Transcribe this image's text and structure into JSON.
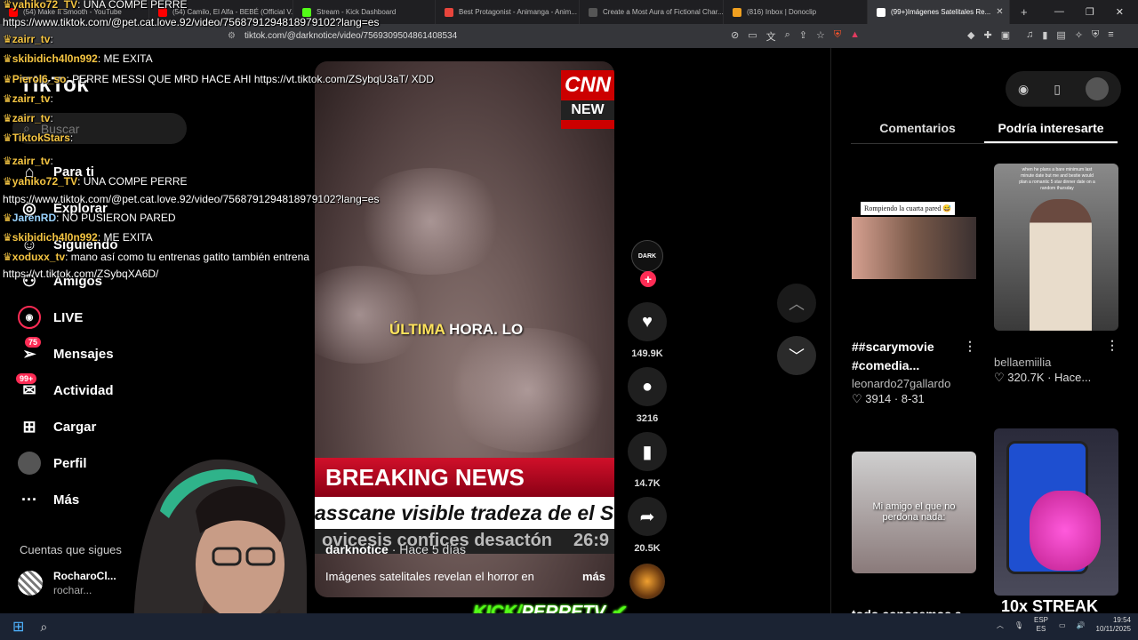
{
  "browser": {
    "tabs": [
      {
        "label": "(54) Make It Smooth - YouTube",
        "color": "#ff0000"
      },
      {
        "label": "(54) Camilo, El Alfa - BEBÉ (Official V...",
        "color": "#ff0000"
      },
      {
        "label": "Stream - Kick Dashboard",
        "color": "#53fc18"
      },
      {
        "label": "Best Protagonist - Animanga - Anim...",
        "color": "#e8453c"
      },
      {
        "label": "Create a Most Aura of Fictional Char...",
        "color": "#555555"
      },
      {
        "label": "(816) Inbox | Donoclip",
        "color": "#f0a020"
      },
      {
        "label": "(99+)Imágenes Satelitales Re...",
        "color": "#ffffff"
      }
    ],
    "url": "tiktok.com/@darknotice/video/7569309504861408534"
  },
  "chat": [
    {
      "user": "yahiko72_TV",
      "text": ": UNA COMPE PERRE",
      "color": "yellow"
    },
    {
      "user": "",
      "text": "https://www.tiktok.com/@pet.cat.love.92/video/7568791294818979102?lang=es",
      "color": ""
    },
    {
      "user": "zairr_tv",
      "text": ":",
      "color": "yellow"
    },
    {
      "user": "skibidich4l0n992",
      "text": ": ME EXITA",
      "color": "yellow"
    },
    {
      "user": "Pierol6_so",
      "text": ": PERRE MESSI QUE MRD HACE AHI https://vt.tiktok.com/ZSybqU3aT/ XDD",
      "color": "yellow"
    },
    {
      "user": "zairr_tv",
      "text": ":",
      "color": "yellow"
    },
    {
      "user": "zairr_tv",
      "text": ":",
      "color": "yellow"
    },
    {
      "user": "TiktokStars",
      "text": ":",
      "color": "yellow"
    },
    {
      "user": "zairr_tv",
      "text": ":",
      "color": "yellow"
    },
    {
      "user": "yahiko72_TV",
      "text": ": UNA COMPE PERRE",
      "color": "yellow"
    },
    {
      "user": "",
      "text": "https://www.tiktok.com/@pet.cat.love.92/video/7568791294818979102?lang=es",
      "color": ""
    },
    {
      "user": "JarenRD",
      "text": ": NO PUSIERON PARED",
      "color": "blue"
    },
    {
      "user": "skibidich4l0n992",
      "text": ": ME EXITA",
      "color": "yellow"
    },
    {
      "user": "xoduxx_tv",
      "text": ": mano así como tu entrenas gatito también entrena",
      "color": "yellow"
    },
    {
      "user": "",
      "text": "https://vt.tiktok.com/ZSybqXA6D/",
      "color": ""
    }
  ],
  "sidebar": {
    "logo": "TikTok",
    "search_placeholder": "Buscar",
    "items": [
      {
        "label": "Para ti",
        "icon": "home-icon"
      },
      {
        "label": "Explorar",
        "icon": "compass-icon"
      },
      {
        "label": "Siguiendo",
        "icon": "following-icon"
      },
      {
        "label": "Amigos",
        "icon": "friends-icon"
      },
      {
        "label": "LIVE",
        "icon": "live-icon"
      },
      {
        "label": "Mensajes",
        "icon": "inbox-icon",
        "badge": "75"
      },
      {
        "label": "Actividad",
        "icon": "activity-icon",
        "badge": "99+"
      },
      {
        "label": "Cargar",
        "icon": "upload-icon"
      },
      {
        "label": "Perfil",
        "icon": "profile-icon"
      },
      {
        "label": "Más",
        "icon": "more-icon"
      }
    ],
    "following_title": "Cuentas que sigues",
    "following": [
      {
        "name": "RocharoCl...",
        "handle": "rochar..."
      }
    ]
  },
  "video": {
    "overlay_text_highlight": "ÚLTIMA",
    "overlay_text": "HORA. LO",
    "cnn_logo": "CNN",
    "cnn_sub": "NEW",
    "breaking": "BREAKING NEWS",
    "ticker": "asscane visible tradeza de el Suda",
    "ticker2": "ovicesis confices desactón",
    "ticker2_time": "26:9",
    "author": "darknotice",
    "time": " · Hace 5 días",
    "caption": "Imágenes satelitales revelan el horror en",
    "more": "más"
  },
  "actions": {
    "creator_label": "DARK",
    "likes": "149.9K",
    "comments": "3216",
    "saves": "14.7K",
    "shares": "20.5K"
  },
  "right_panel": {
    "tabs": [
      "Comentarios",
      "Podría interesarte"
    ],
    "cards": [
      {
        "title": "##scarymovie #comedia...",
        "user": "leonardo27gallardo",
        "likes": "3914",
        "date": "8-31",
        "overlay": "Rompiendo la cuarta pared 😅"
      },
      {
        "title": "",
        "user": "bellaemiilia",
        "likes": "320.7K",
        "date": "Hace...",
        "overlay": "when he plans a bare minimum last minute date but me and bestie would plan a romantic 5 star dinner date on a random thursday"
      },
      {
        "title": "todo conocemos a...",
        "user": "",
        "likes": "",
        "date": "",
        "overlay": "Mi amigo el que no perdona nada:"
      },
      {
        "title": "",
        "user": "",
        "likes": "",
        "date": "",
        "overlay": ""
      }
    ]
  },
  "stream": {
    "kick_label": "KICK/",
    "kick_name": "PERRETV",
    "streak": "10x STREAK"
  },
  "taskbar": {
    "lang1": "ESP",
    "lang2": "ES",
    "time": "19:54",
    "date": "10/11/2025"
  }
}
